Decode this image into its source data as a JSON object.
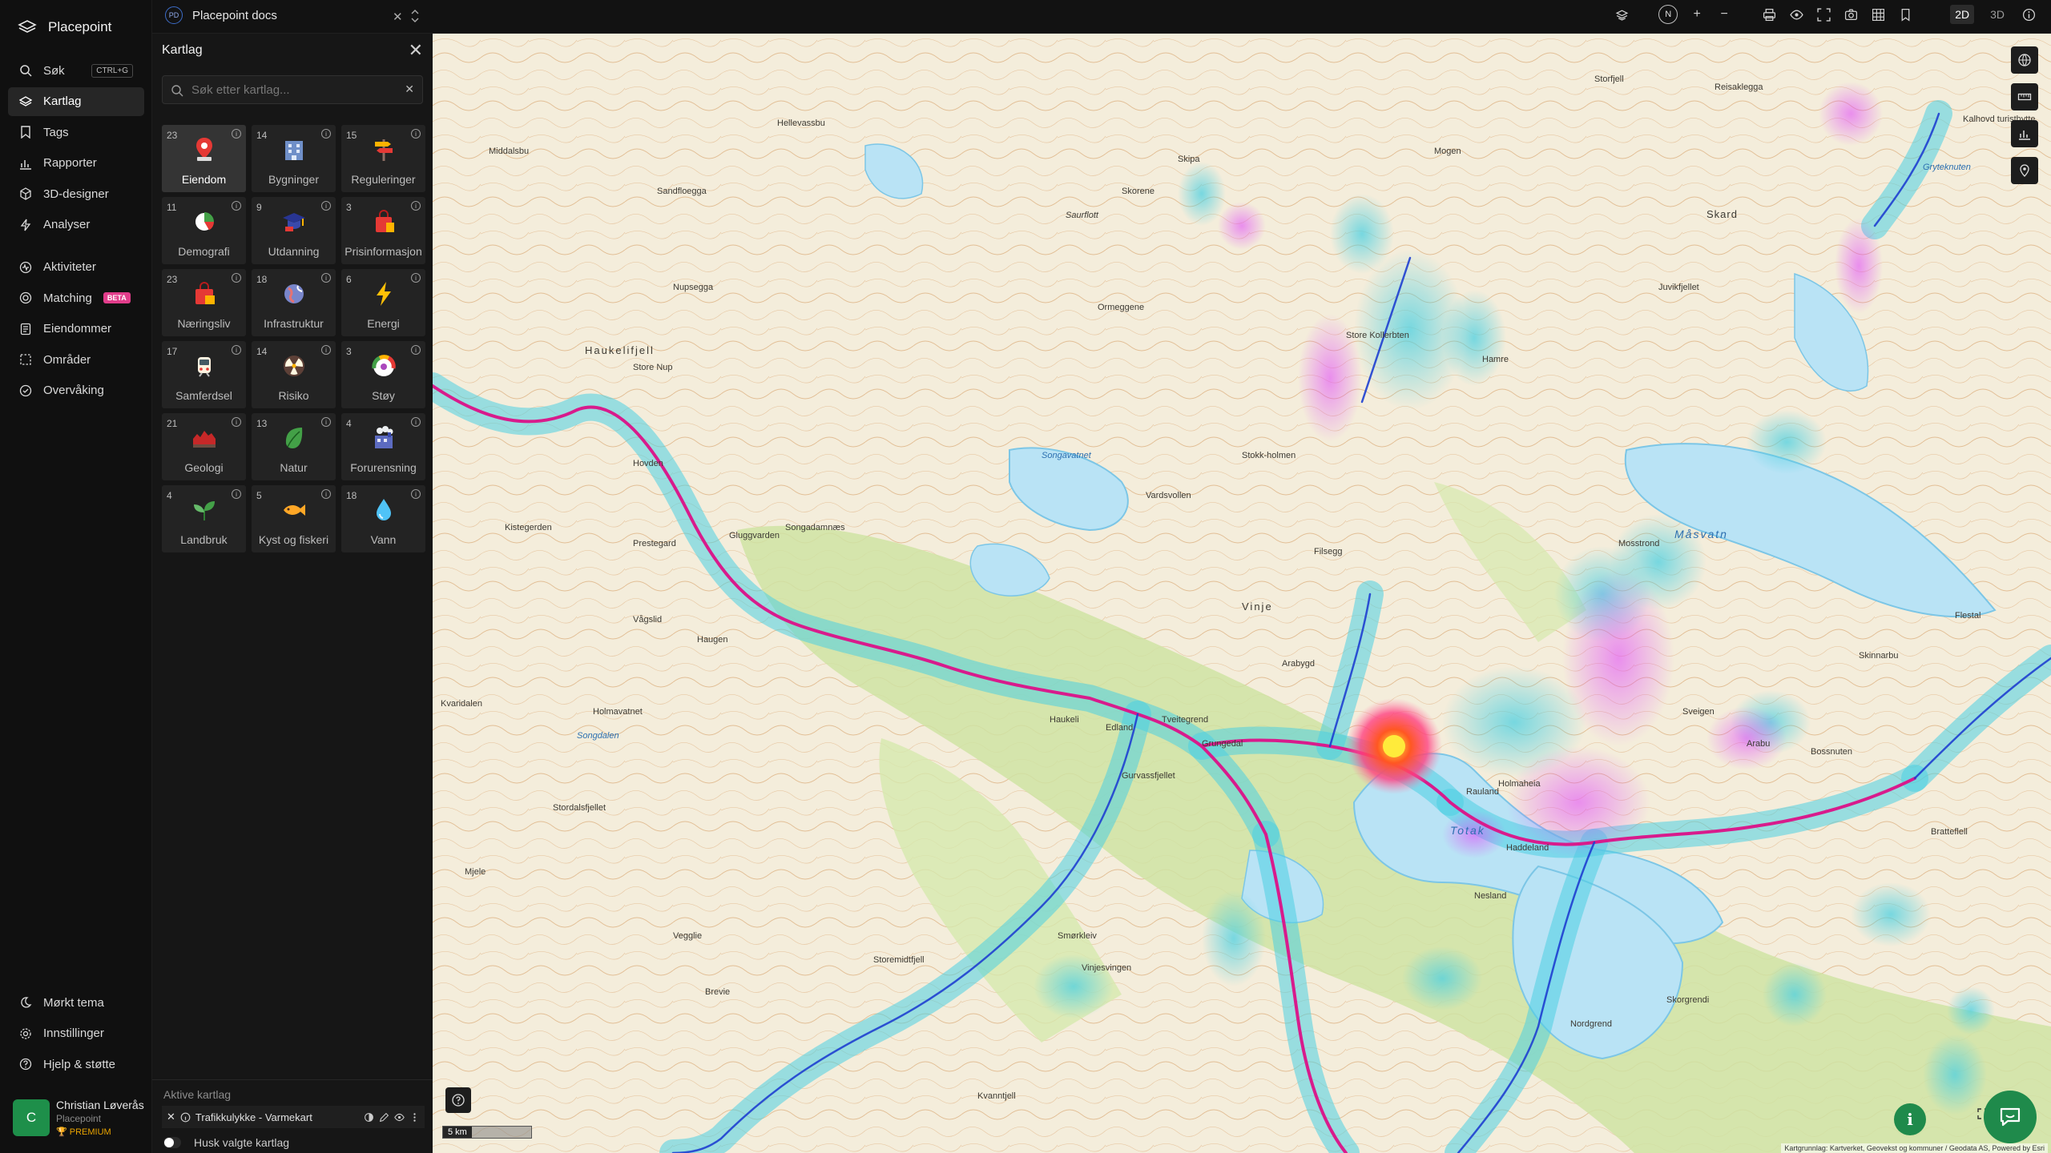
{
  "app": {
    "name": "Placepoint"
  },
  "nav": {
    "items": [
      {
        "label": "Søk",
        "shortcut": "CTRL+G"
      },
      {
        "label": "Kartlag"
      },
      {
        "label": "Tags"
      },
      {
        "label": "Rapporter"
      },
      {
        "label": "3D-designer"
      },
      {
        "label": "Analyser"
      },
      {
        "label": "Aktiviteter"
      },
      {
        "label": "Matching",
        "badge": "BETA"
      },
      {
        "label": "Eiendommer"
      },
      {
        "label": "Områder"
      },
      {
        "label": "Overvåking"
      }
    ],
    "bottom": [
      {
        "label": "Mørkt tema"
      },
      {
        "label": "Innstillinger"
      },
      {
        "label": "Hjelp & støtte"
      }
    ],
    "user": {
      "initial": "C",
      "name": "Christian Løverås",
      "org": "Placepoint",
      "plan": "PREMIUM"
    }
  },
  "topbar": {
    "doc_badge": "PD",
    "doc_title": "Placepoint docs",
    "compass": "N",
    "view_2d": "2D",
    "view_3d": "3D",
    "active_view": "2D"
  },
  "panel": {
    "title": "Kartlag",
    "search_placeholder": "Søk etter kartlag...",
    "categories": [
      {
        "count": "23",
        "label": "Eiendom",
        "active": true
      },
      {
        "count": "14",
        "label": "Bygninger"
      },
      {
        "count": "15",
        "label": "Reguleringer"
      },
      {
        "count": "11",
        "label": "Demografi"
      },
      {
        "count": "9",
        "label": "Utdanning"
      },
      {
        "count": "3",
        "label": "Prisinformasjon"
      },
      {
        "count": "23",
        "label": "Næringsliv"
      },
      {
        "count": "18",
        "label": "Infrastruktur"
      },
      {
        "count": "6",
        "label": "Energi"
      },
      {
        "count": "17",
        "label": "Samferdsel"
      },
      {
        "count": "14",
        "label": "Risiko"
      },
      {
        "count": "3",
        "label": "Støy"
      },
      {
        "count": "21",
        "label": "Geologi"
      },
      {
        "count": "13",
        "label": "Natur"
      },
      {
        "count": "4",
        "label": "Forurensning"
      },
      {
        "count": "4",
        "label": "Landbruk"
      },
      {
        "count": "5",
        "label": "Kyst og fiskeri"
      },
      {
        "count": "18",
        "label": "Vann"
      }
    ],
    "active_layers_title": "Aktive kartlag",
    "active_layer": "Trafikkulykke - Varmekart",
    "remember_label": "Husk valgte kartlag"
  },
  "map": {
    "scale_label": "5 km",
    "attribution": "Kartgrunnlag: Kartverket, Geovekst og kommuner / Geodata AS, Powered by Esri",
    "place_labels": [
      "Haukelifjell",
      "Skipa",
      "Skorene",
      "Saurflott",
      "Store Nup",
      "Sandfloegga",
      "Nupsegga",
      "Hellevassbu",
      "Middalsbu",
      "Ormeggene",
      "Store Kollerbten",
      "Hamre",
      "Juvikfjellet",
      "Skard",
      "Storfjell",
      "Mogen",
      "Stokk-holmen",
      "Vardsvollen",
      "Songavatnet",
      "Filsegg",
      "Måsvatn",
      "Mosstrond",
      "Vinje",
      "Haukeli",
      "Edland",
      "Tveitegrend",
      "Grungedal",
      "Arabygd",
      "Gurvassfjellet",
      "Totak",
      "Haddeland",
      "Nesland",
      "Rauland",
      "Kvaridalen",
      "Holmavatnet",
      "Songdalen",
      "Stordalsfjellet",
      "Vegglie",
      "Brevie",
      "Storemidtfjell",
      "Smørkleiv",
      "Vinjesvingen",
      "Kvanntjell",
      "Skorgrendi",
      "Nordgrend",
      "Bossnuten",
      "Arabu",
      "Sveigen",
      "Flestal",
      "Skinnarbu",
      "Holmaheia",
      "Bratteflell",
      "Mjele",
      "Kistegerden",
      "Gluggvarden",
      "Songadamnæs",
      "Hovden",
      "Prestegard",
      "Vågslid",
      "Haugen",
      "Reisaklegga",
      "Kalhovd turisthytte",
      "Gryteknuten"
    ]
  }
}
